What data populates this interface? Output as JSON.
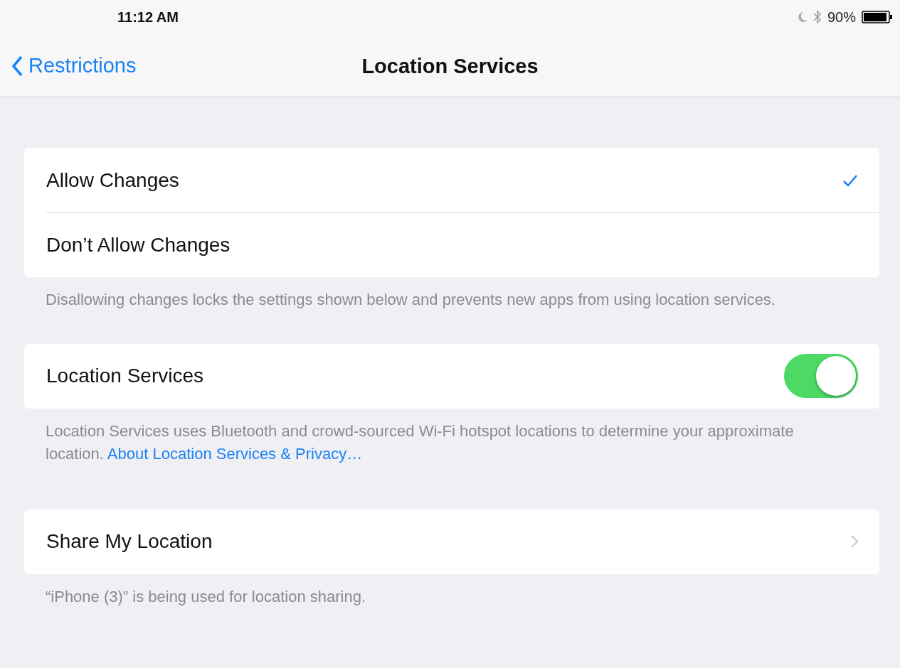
{
  "status_bar": {
    "time": "11:12 AM",
    "battery_percent": "90%"
  },
  "nav_bar": {
    "back": "Restrictions",
    "title": "Location Services"
  },
  "sections": [
    {
      "rows": [
        {
          "kind": "check",
          "label": "Allow Changes",
          "selected": true
        },
        {
          "kind": "check",
          "label": "Don’t Allow Changes",
          "selected": false
        }
      ],
      "footer": {
        "text": "Disallowing changes locks the settings shown below and prevents new apps from using location services."
      }
    },
    {
      "rows": [
        {
          "kind": "toggle",
          "label": "Location Services",
          "on": true
        }
      ],
      "footer": {
        "text": "Location Services uses Bluetooth and crowd-sourced Wi-Fi hotspot locations to determine your approximate location.",
        "link": "About Location Services & Privacy…"
      }
    },
    {
      "rows": [
        {
          "kind": "disclosure",
          "label": "Share My Location"
        }
      ],
      "footer": {
        "text": "“iPhone (3)” is being used for location sharing."
      }
    }
  ]
}
